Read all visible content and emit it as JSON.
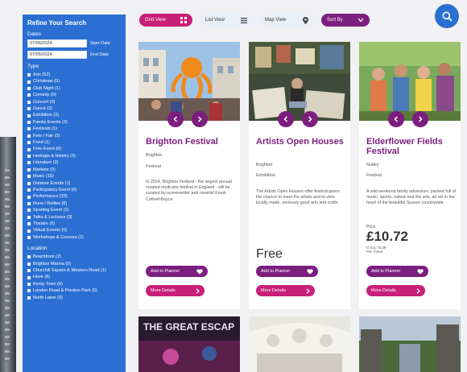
{
  "sidebar": {
    "title": "Refine Your Search",
    "dates_heading": "Dates",
    "start_date_value": "07/05/2024",
    "start_date_label": "Start Date",
    "end_date_value": "07/05/2024",
    "end_date_label": "End Date",
    "type_heading": "Type",
    "types": [
      "Arts (52)",
      "Christmas (0)",
      "Club Night (1)",
      "Comedy (6)",
      "Concert (0)",
      "Dance (2)",
      "Exhibition (2)",
      "Family Events (3)",
      "Festivals (1)",
      "Fete / Fair (3)",
      "Food (1)",
      "Free Event (6)",
      "Heritage & History (3)",
      "Literature (2)",
      "Markets (0)",
      "Music (15)",
      "Outdoor Events (1)",
      "Participatory Event (6)",
      "Performance (23)",
      "Runs / Rallies (8)",
      "Sporting Event (1)",
      "Talks & Lectures (3)",
      "Theatre (6)",
      "Virtual Events (0)",
      "Workshops & Courses (2)"
    ],
    "location_heading": "Location",
    "locations": [
      "Beachfront (2)",
      "Brighton Marina (0)",
      "Churchill Square & Western Road (1)",
      "Hove (8)",
      "Kemp Town (6)",
      "London Road & Preston Park (6)",
      "North Laine (9)"
    ]
  },
  "toolbar": {
    "grid_view": "Grid View",
    "list_view": "List View",
    "map_view": "Map View",
    "sort_by": "Sort By"
  },
  "cards": [
    {
      "title": "Brighton Festival",
      "location": "Brighton",
      "category": "Festival",
      "description": "In 2024, Brighton Festival - the largest annual curated multi-arts festival in England - will be curated by screenwriter and novelist Frank Cottrell-Boyce.",
      "add_to_planner": "Add to Planner",
      "more_details": "More Details"
    },
    {
      "title": "Artists Open Houses",
      "location": "Brighton",
      "category": "Exhibition",
      "description": "The Artists Open Houses offer festival-goers the chance to meet the artists and to view locally made, seriously good arts and crafts.",
      "price": "Free",
      "add_to_planner": "Add to Planner",
      "more_details": "More Details"
    },
    {
      "title": "Elderflower Fields Festival",
      "location": "Nutley",
      "category": "Festival",
      "description": "A wild weekend family adventure, packed full of music, sports, nature and the arts, all set in the heart of the beautiful Sussex countryside",
      "price_label": "Price",
      "price": "£10.72",
      "price_sub_1": "Is £11.75.39",
      "price_sub_2": "Per Ticket",
      "add_to_planner": "Add to Planner",
      "more_details": "More Details"
    }
  ],
  "second_row": {
    "card1_image_text": "THE GREAT ESCAP"
  },
  "colors": {
    "sidebar_blue": "#2a6fd1",
    "purple": "#7b1e7e",
    "magenta": "#c81f78"
  }
}
